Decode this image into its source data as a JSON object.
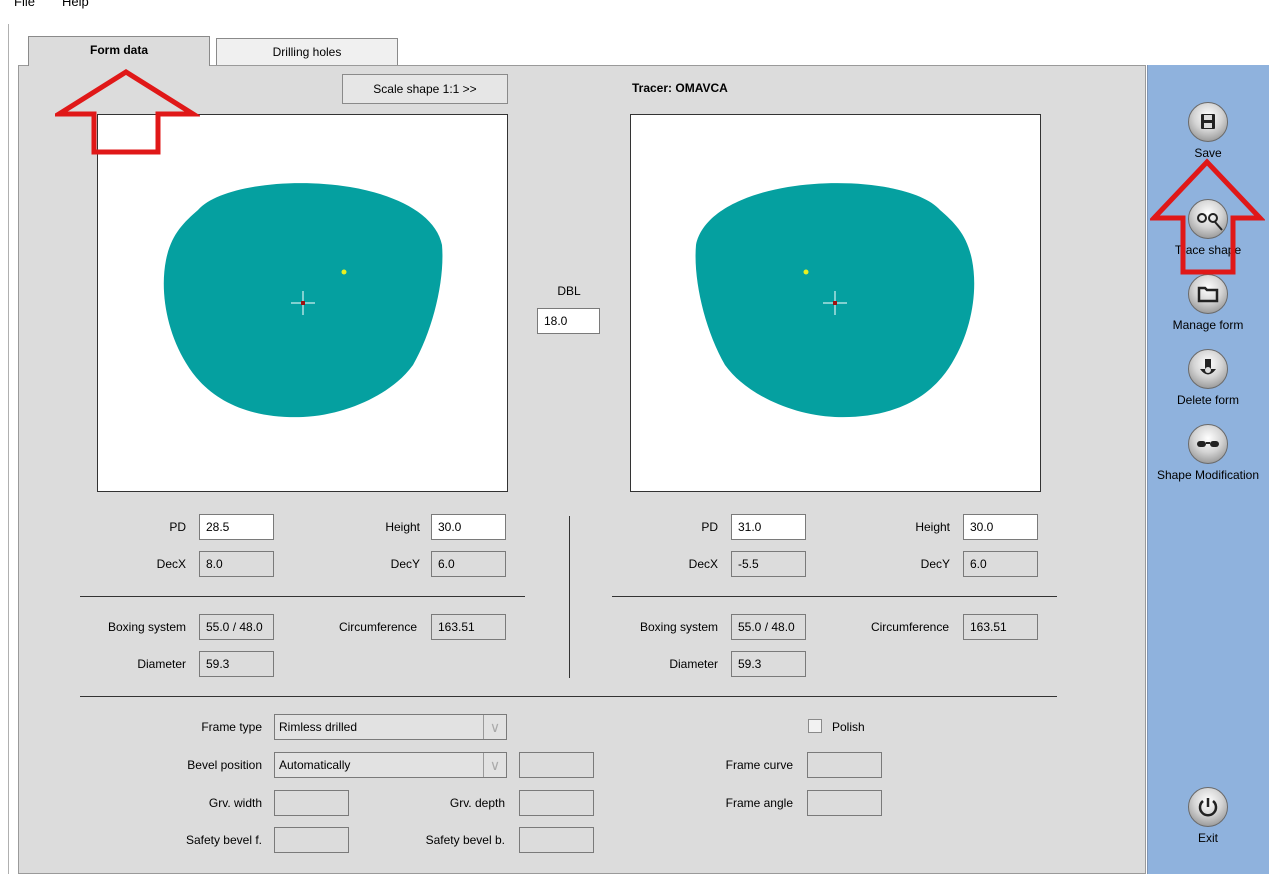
{
  "menu": {
    "file": "File",
    "help": "Help"
  },
  "tabs": [
    {
      "label": "Form data"
    },
    {
      "label": "Drilling holes"
    }
  ],
  "scale_button": "Scale shape 1:1 >>",
  "tracer": "Tracer: OMAVCA",
  "dbl": {
    "label": "DBL",
    "value": "18.0"
  },
  "right_lens": {
    "pd_label": "PD",
    "pd": "28.5",
    "height_label": "Height",
    "height": "30.0",
    "decx_label": "DecX",
    "decx": "8.0",
    "decy_label": "DecY",
    "decy": "6.0",
    "boxing_label": "Boxing system",
    "boxing": "55.0 / 48.0",
    "circ_label": "Circumference",
    "circ": "163.51",
    "diam_label": "Diameter",
    "diam": "59.3"
  },
  "left_lens": {
    "pd_label": "PD",
    "pd": "31.0",
    "height_label": "Height",
    "height": "30.0",
    "decx_label": "DecX",
    "decx": "-5.5",
    "decy_label": "DecY",
    "decy": "6.0",
    "boxing_label": "Boxing system",
    "boxing": "55.0 / 48.0",
    "circ_label": "Circumference",
    "circ": "163.51",
    "diam_label": "Diameter",
    "diam": "59.3"
  },
  "frame": {
    "type_label": "Frame type",
    "type_value": "Rimless drilled",
    "bevel_label": "Bevel position",
    "bevel_value": "Automatically",
    "grv_width_label": "Grv. width",
    "grv_depth_label": "Grv. depth",
    "safety_f_label": "Safety bevel f.",
    "safety_b_label": "Safety bevel b.",
    "polish_label": "Polish",
    "curve_label": "Frame curve",
    "angle_label": "Frame angle"
  },
  "sidebar": {
    "save": "Save",
    "trace": "Trace shape",
    "manage": "Manage form",
    "delete": "Delete form",
    "modify": "Shape Modification",
    "exit": "Exit"
  },
  "colors": {
    "shape_fill": "#05a0a0",
    "sidebar_bg": "#8fb2dd",
    "annotation": "#e01818"
  }
}
